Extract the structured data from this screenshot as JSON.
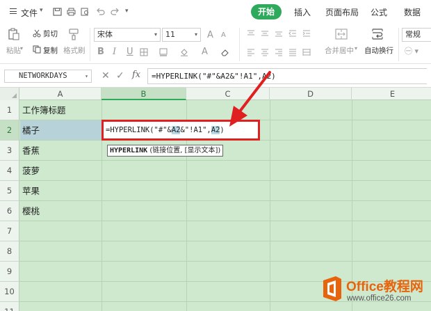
{
  "menubar": {
    "file_label": "文件",
    "tabs": [
      "开始",
      "插入",
      "页面布局",
      "公式",
      "数据"
    ],
    "active_tab": "开始"
  },
  "ribbon": {
    "paste_label": "粘贴",
    "cut_label": "剪切",
    "copy_label": "复制",
    "format_painter_label": "格式刷",
    "font_name": "宋体",
    "font_size": "11",
    "bold_label": "B",
    "italic_label": "I",
    "underline_label": "U",
    "increase_font_label": "A",
    "decrease_font_label": "A",
    "merge_center_label": "合并居中",
    "wrap_text_label": "自动换行",
    "number_format_label": "常规"
  },
  "formula_bar": {
    "name_box": "NETWORKDAYS",
    "fx_label": "fx",
    "formula": "=HYPERLINK(\"#\"&A2&\"!A1\",A2)"
  },
  "grid": {
    "columns": [
      "A",
      "B",
      "C",
      "D",
      "E"
    ],
    "rows": [
      "1",
      "2",
      "3",
      "4",
      "5",
      "6",
      "7",
      "8",
      "9",
      "10",
      "11"
    ],
    "cells_a": [
      "工作簿标题",
      "橘子",
      "香蕉",
      "菠萝",
      "苹果",
      "樱桃"
    ],
    "editing_cell": {
      "part1": "=HYPERLINK(\"#\"&",
      "ref1": "A2",
      "part2": "&\"!A1\",",
      "ref2": "A2",
      "part3": ")"
    },
    "tooltip": {
      "function": "HYPERLINK",
      "args": "(链接位置, [显示文本])"
    }
  },
  "watermark": {
    "title": "Office教程网",
    "url": "www.office26.com"
  },
  "colors": {
    "accent": "#2fa95b",
    "highlight_box": "#e02020",
    "sheet_bg": "#cfe9cf",
    "watermark_orange": "#e8640c"
  }
}
